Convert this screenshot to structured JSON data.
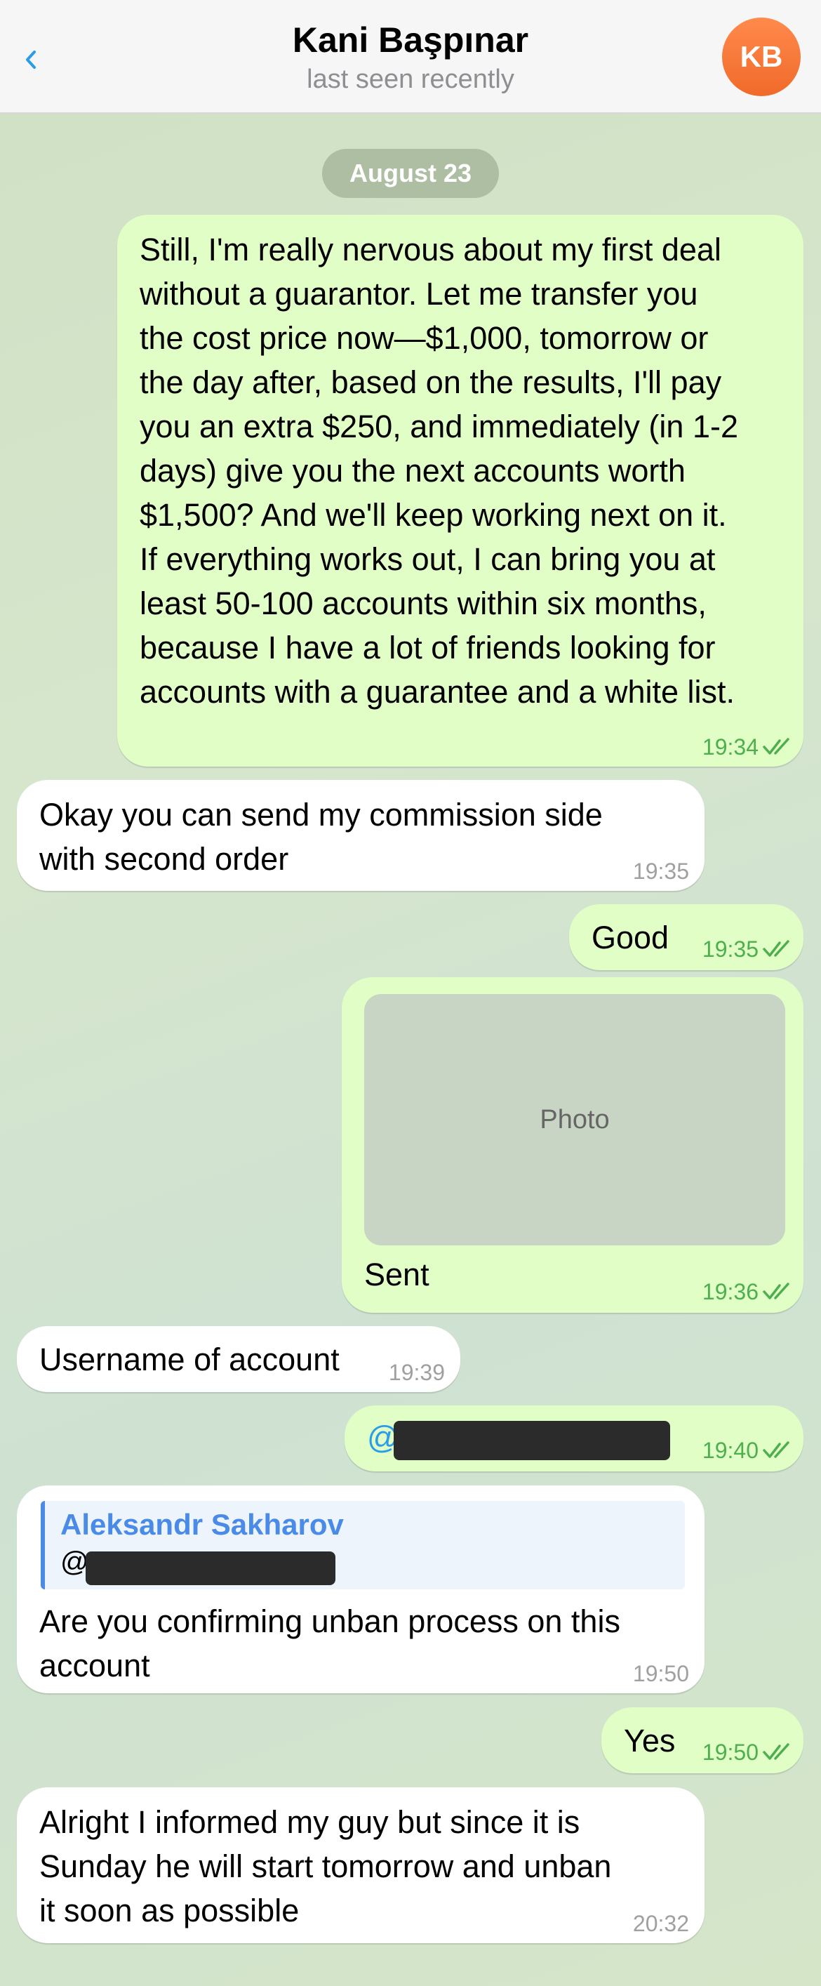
{
  "header": {
    "back_label": "<",
    "title": "Kani Başpınar",
    "subtitle": "last seen recently",
    "avatar_initials": "KB"
  },
  "date_label": "August 23",
  "messages": [
    {
      "direction": "out",
      "text": "Still, I'm really nervous about my first deal\nwithout a guarantor. Let me transfer you\nthe cost price now—$1,000, tomorrow or\nthe day after, based on the results, I'll pay\nyou an extra $250, and immediately (in 1-2\ndays) give you the next accounts worth\n$1,500? And we'll keep working next on it.\nIf everything works out, I can bring you at\nleast 50-100 accounts within six months,\nbecause I have a lot of friends looking for\naccounts with a guarantee and a white list.",
      "time": "19:34",
      "read": true
    },
    {
      "direction": "in",
      "text": "Okay you can send my commission side\nwith second order",
      "time": "19:35"
    },
    {
      "direction": "out",
      "text": "Good",
      "time": "19:35",
      "read": true
    },
    {
      "direction": "out",
      "photo_label": "Photo",
      "text": "Sent",
      "time": "19:36",
      "read": true
    },
    {
      "direction": "in",
      "text": "Username of account",
      "time": "19:39"
    },
    {
      "direction": "out",
      "text": "@",
      "redacted": true,
      "time": "19:40",
      "read": true
    },
    {
      "direction": "in",
      "reply_to": {
        "name": "Aleksandr Sakharov",
        "text": "@"
      },
      "text": "Are you confirming unban process on this\naccount",
      "time": "19:50"
    },
    {
      "direction": "out",
      "text": "Yes",
      "time": "19:50",
      "read": true
    },
    {
      "direction": "in",
      "text": "Alright I informed my guy but since it is\nSunday he will start tomorrow and unban\nit soon as possible",
      "time": "20:32"
    }
  ],
  "colors": {
    "outgoing_bubble": "#e1fec6",
    "incoming_bubble": "#ffffff",
    "accent": "#2a9ce8",
    "read_check": "#4fae4e",
    "avatar": "#f06a2a"
  },
  "icons": {
    "back": "chevron-left-icon",
    "read": "double-check-icon"
  }
}
